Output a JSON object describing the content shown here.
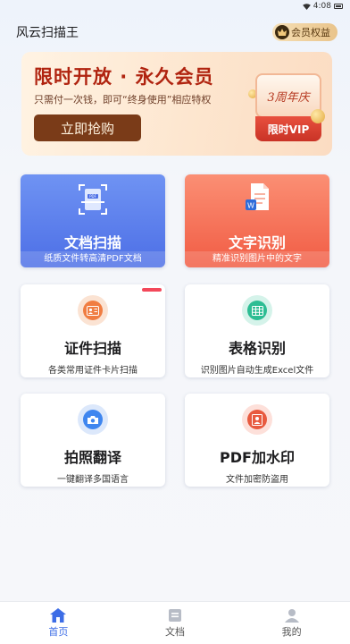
{
  "status_bar": {
    "time": "4:08"
  },
  "header": {
    "title": "风云扫描王",
    "vip_chip_label": "会员权益"
  },
  "banner": {
    "title": "限时开放 · 永久会员",
    "subtitle": "只需付一次钱，即可“终身使用”相应特权",
    "buy_button": "立即抢购",
    "badge_top": "3周年庆",
    "badge_bottom": "限时VIP"
  },
  "features": [
    {
      "title": "文档扫描",
      "subtitle": "纸质文件转高清PDF文档",
      "icon": "document-scan-icon",
      "style": "blue"
    },
    {
      "title": "文字识别",
      "subtitle": "精准识别图片中的文字",
      "icon": "text-recognition-icon",
      "style": "red"
    },
    {
      "title": "证件扫描",
      "subtitle": "各类常用证件卡片扫描",
      "icon": "id-card-icon",
      "style": "white"
    },
    {
      "title": "表格识别",
      "subtitle": "识别图片自动生成Excel文件",
      "icon": "table-icon",
      "style": "white"
    },
    {
      "title": "拍照翻译",
      "subtitle": "一键翻译多国语言",
      "icon": "camera-icon",
      "style": "white"
    },
    {
      "title": "PDF加水印",
      "subtitle": "文件加密防盗用",
      "icon": "watermark-icon",
      "style": "white"
    }
  ],
  "bottom_nav": [
    {
      "label": "首页",
      "icon": "home-icon",
      "active": true
    },
    {
      "label": "文档",
      "icon": "document-icon",
      "active": false
    },
    {
      "label": "我的",
      "icon": "user-icon",
      "active": false
    }
  ],
  "colors": {
    "accent": "#3d6de6",
    "banner_title": "#b0230f",
    "buy_button": "#7a3b18",
    "card_blue": "#5b7ff0",
    "card_red": "#f4694f"
  }
}
